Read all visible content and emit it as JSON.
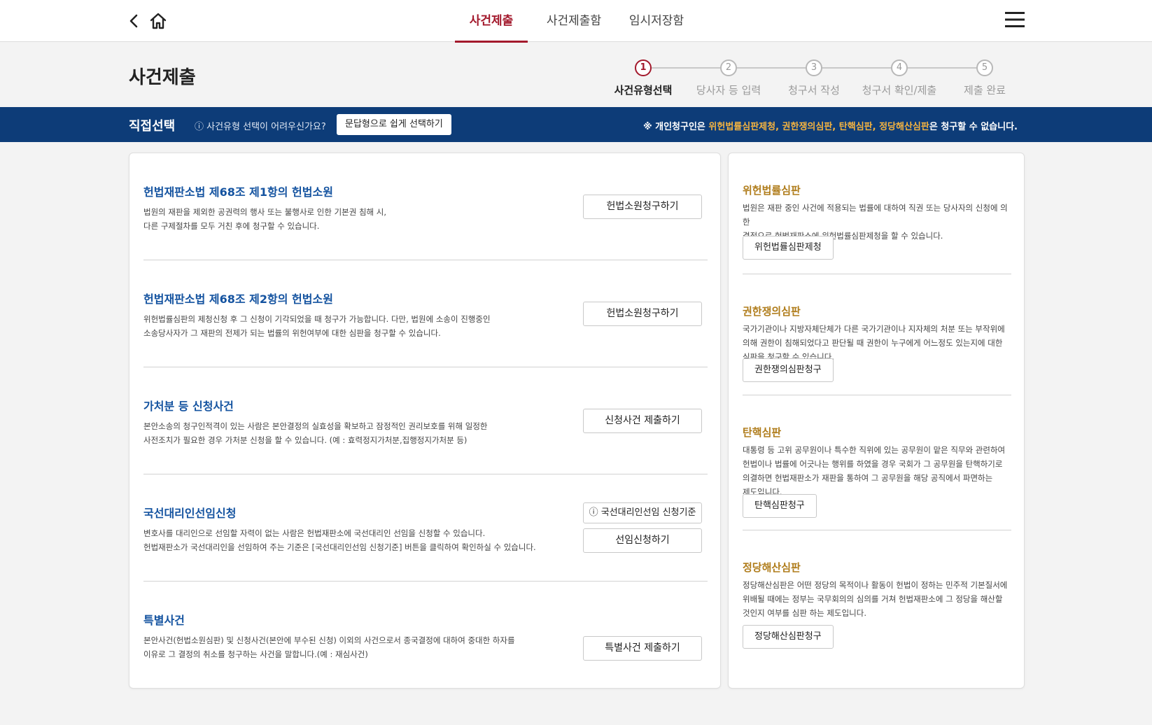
{
  "nav": {
    "tabs": [
      "사건제출",
      "사건제출함",
      "임시저장함"
    ]
  },
  "header": {
    "title": "사건제출",
    "steps": [
      {
        "num": "1",
        "label": "사건유형선택"
      },
      {
        "num": "2",
        "label": "당사자 등 입력"
      },
      {
        "num": "3",
        "label": "청구서 작성"
      },
      {
        "num": "4",
        "label": "청구서 확인/제출"
      },
      {
        "num": "5",
        "label": "제출 완료"
      }
    ]
  },
  "bar": {
    "title": "직접선택",
    "help": "ⓘ 사건유형 선택이 어려우신가요?",
    "button": "문답형으로 쉽게 선택하기",
    "notice_prefix": "※ 개인청구인은 ",
    "notice_items": "위헌법률심판제청, 권한쟁의심판, 탄핵심판, 정당해산심판",
    "notice_suffix": "은 청구할 수 없습니다."
  },
  "left": [
    {
      "title": "헌법재판소법 제68조 제1항의 헌법소원",
      "desc1": "법원의 재판을 제외한 공권력의 행사 또는 불행사로 인한 기본권 침해 시,",
      "desc2": "다른 구제절차를 모두 거친 후에 청구할 수 있습니다.",
      "button": "헌법소원청구하기"
    },
    {
      "title": "헌법재판소법 제68조 제2항의 헌법소원",
      "desc1": "위헌법률심판의 제청신청 후 그 신청이 기각되었을 때 청구가 가능합니다. 다만, 법원에 소송이 진행중인",
      "desc2": "소송당사자가 그 재판의 전제가 되는 법률의 위헌여부에 대한 심판을 청구할 수 있습니다.",
      "button": "헌법소원청구하기"
    },
    {
      "title": "가처분 등 신청사건",
      "desc1": "본안소송의 청구인적격이 있는 사람은 본안결정의 실효성을 확보하고 잠정적인 권리보호를 위해 일정한",
      "desc2": "사전조치가 필요한 경우 가처분 신청을 할 수 있습니다. (예 : 효력정지가처분,집행정지가처분 등)",
      "button": "신청사건 제출하기"
    },
    {
      "title": "국선대리인선임신청",
      "desc1": "변호사를 대리인으로 선임할 자력이 없는 사람은 헌법재판소에 국선대리인 선임을 신청할 수 있습니다.",
      "desc2": "헌법재판소가 국선대리인을 선임하여 주는 기준은 [국선대리인선임 신청기준] 버튼을 클릭하여 확인하실 수 있습니다.",
      "button_info": "ⓘ 국선대리인선임 신청기준",
      "button": "선임신청하기"
    },
    {
      "title": "특별사건",
      "desc1": "본안사건(헌법소원심판) 및 신청사건(본안에 부수된 신청) 이외의 사건으로서 종국결정에 대하여 중대한 하자를",
      "desc2": "이유로 그 결정의 취소를 청구하는 사건을 말합니다.(예 : 재심사건)",
      "button": "특별사건 제출하기"
    }
  ],
  "right": [
    {
      "title": "위헌법률심판",
      "lines": [
        "법원은 재판 중인 사건에 적용되는 법률에 대하여 직권 또는 당사자의 신청에 의한",
        "결정으로 헌법재판소에 위헌법률심판제청을 할 수 있습니다."
      ],
      "button": "위헌법률심판제청"
    },
    {
      "title": "권한쟁의심판",
      "lines": [
        "국가기관이나 지방자체단체가 다른 국가기관이나 지자체의 처분 또는 부작위에",
        "의해 권한이 침해되었다고 판단될 때 권한이 누구에게 어느정도 있는지에 대한",
        "심판을 청구할 수 있습니다."
      ],
      "button": "권한쟁의심판청구"
    },
    {
      "title": "탄핵심판",
      "lines": [
        "대통령 등 고위 공무원이나 특수한 직위에 있는 공무원이 맡은 직무와 관련하여",
        "헌법이나 법률에 어긋나는 행위를 하였을 경우 국회가 그 공무원을 탄핵하기로",
        "의결하면 헌법재판소가 재판을 통하여 그 공무원을 해당 공직에서 파면하는",
        "제도입니다."
      ],
      "button": "탄핵심판청구"
    },
    {
      "title": "정당해산심판",
      "lines": [
        "정당해산심판은 어떤 정당의 목적이나 활동이 헌법이 정하는 민주적 기본질서에",
        "위배될 때에는 정부는 국무회의의 심의를 거쳐 헌법재판소에 그 정당을 해산할",
        "것인지 여부를 심판 하는 제도입니다."
      ],
      "button": "정당해산심판청구"
    }
  ]
}
